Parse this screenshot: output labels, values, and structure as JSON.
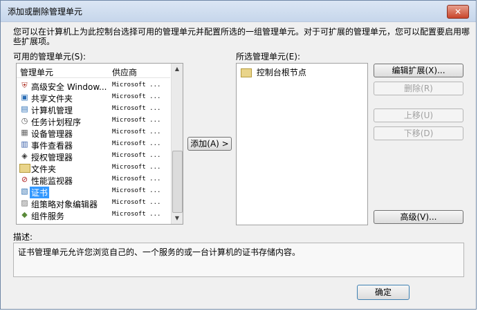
{
  "window": {
    "title": "添加或删除管理单元",
    "close": "✕"
  },
  "intro": "您可以在计算机上为此控制台选择可用的管理单元并配置所选的一组管理单元。对于可扩展的管理单元，您可以配置要启用哪些扩展项。",
  "available": {
    "label": "可用的管理单元(S):",
    "headers": {
      "name": "管理单元",
      "vendor": "供应商"
    },
    "rows": [
      {
        "name": "高级安全 Window...",
        "vendor": "Microsoft ...",
        "icon": "shield-icon"
      },
      {
        "name": "共享文件夹",
        "vendor": "Microsoft ...",
        "icon": "shared-folder-icon"
      },
      {
        "name": "计算机管理",
        "vendor": "Microsoft ...",
        "icon": "computer-management-icon"
      },
      {
        "name": "任务计划程序",
        "vendor": "Microsoft ...",
        "icon": "clock-icon"
      },
      {
        "name": "设备管理器",
        "vendor": "Microsoft ...",
        "icon": "device-icon"
      },
      {
        "name": "事件查看器",
        "vendor": "Microsoft ...",
        "icon": "event-icon"
      },
      {
        "name": "授权管理器",
        "vendor": "Microsoft ...",
        "icon": "authorization-icon"
      },
      {
        "name": "文件夹",
        "vendor": "Microsoft ...",
        "icon": "folder-icon"
      },
      {
        "name": "性能监视器",
        "vendor": "Microsoft ...",
        "icon": "performance-icon"
      },
      {
        "name": "证书",
        "vendor": "Microsoft ...",
        "icon": "certificate-icon",
        "selected": true
      },
      {
        "name": "组策略对象编辑器",
        "vendor": "Microsoft ...",
        "icon": "policy-icon"
      },
      {
        "name": "组件服务",
        "vendor": "Microsoft ...",
        "icon": "component-icon"
      }
    ]
  },
  "add_button": "添加(A) >",
  "selected": {
    "label": "所选管理单元(E):",
    "root": "控制台根节点"
  },
  "buttons": {
    "edit_ext": "编辑扩展(X)...",
    "delete": "删除(R)",
    "move_up": "上移(U)",
    "move_down": "下移(D)",
    "advanced": "高级(V)..."
  },
  "description": {
    "label": "描述:",
    "text": "证书管理单元允许您浏览自己的、一个服务的或一台计算机的证书存储内容。"
  },
  "ok_button": "确定"
}
